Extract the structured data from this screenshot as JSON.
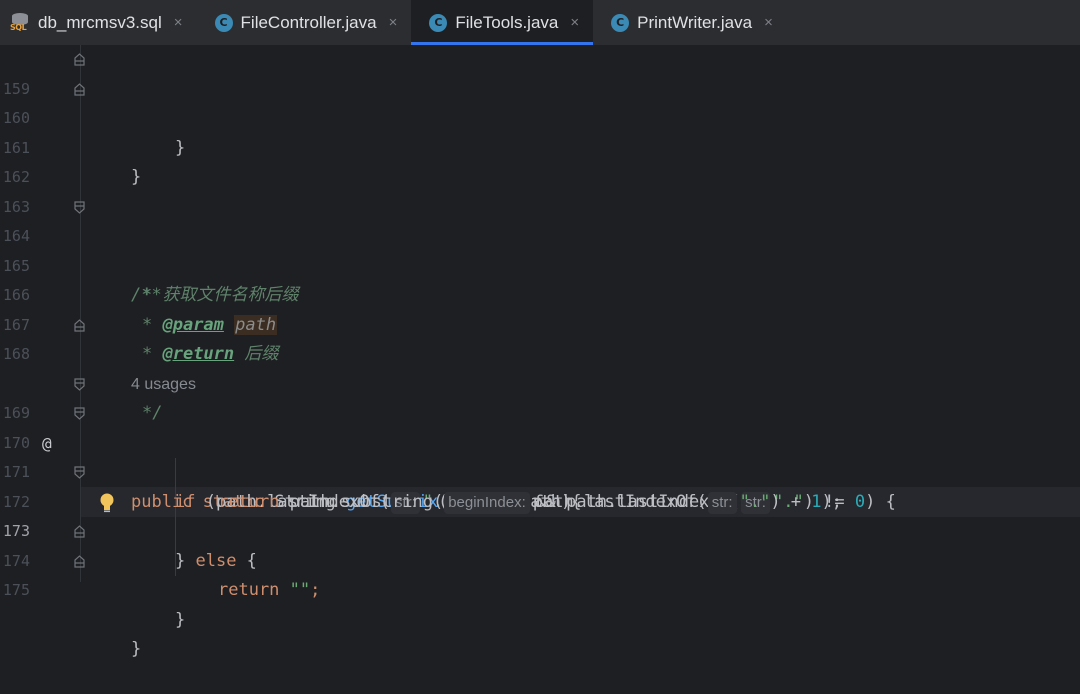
{
  "tabs": [
    {
      "label": "db_mrcmsv3.sql",
      "icon": "sql-file-icon",
      "active": false
    },
    {
      "label": "FileController.java",
      "icon": "class-c-icon",
      "active": false
    },
    {
      "label": "FileTools.java",
      "icon": "class-c-icon",
      "active": true
    },
    {
      "label": "PrintWriter.java",
      "icon": "class-c-icon",
      "active": false
    }
  ],
  "close_glyph": "×",
  "sql_label": "SQL",
  "class_letter": "C",
  "line_numbers": [
    "159",
    "160",
    "161",
    "162",
    "163",
    "164",
    "165",
    "166",
    "167",
    "168",
    "169",
    "170",
    "171",
    "172",
    "173",
    "174",
    "175"
  ],
  "current_line": "173",
  "usages": "4 usages",
  "code": {
    "l159": "}",
    "l160": "}",
    "l164": "/**",
    "l165_star": "* ",
    "l165_text": "获取文件名称后缀",
    "l166_star": "* ",
    "l166_tag": "@param",
    "l166_name": "path",
    "l167_star": "* ",
    "l167_tag": "@return",
    "l167_text": "后缀",
    "l168": "*/",
    "l169_kw1": "public",
    "l169_kw2": "static",
    "l169_type": "String",
    "l169_fn": "getSuffix",
    "l169_rest": "(String path){",
    "l170_kw": "if",
    "l170_a": " (path.lastIndexOf(",
    "l170_hint": "str:",
    "l170_s1": "\".\"",
    "l170_b": ") != ",
    "l170_n1": "-1",
    "l170_c": " && path.lastIndexOf(",
    "l170_s2": "\".\"",
    "l170_d": ") != ",
    "l170_n2": "0",
    "l170_e": ") {",
    "l171_kw": "return",
    "l171_a": " path.substring(",
    "l171_hint1": "beginIndex:",
    "l171_b": "path.lastIndexOf(",
    "l171_hint2": "str:",
    "l171_s": "\".\"",
    "l171_c": ") + ",
    "l171_n": "1",
    "l171_d": ");",
    "l172_a": "} ",
    "l172_kw": "else",
    "l172_b": " {",
    "l173_kw": "return",
    "l173_s": "\"\"",
    "l173_end": ";",
    "l174": "}",
    "l175": "}"
  },
  "gutter_mark": "@"
}
